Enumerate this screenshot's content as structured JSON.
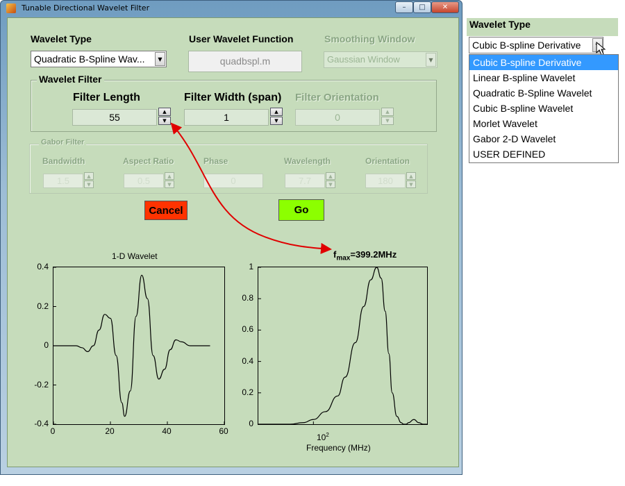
{
  "window": {
    "title": "Tunable Directional Wavelet Filter",
    "minimize_glyph": "–",
    "maximize_glyph": "□",
    "close_glyph": "✕"
  },
  "controls": {
    "wavelet_type_label": "Wavelet Type",
    "wavelet_type_value": "Quadratic B-Spline Wav...",
    "user_wavelet_label": "User Wavelet Function",
    "user_wavelet_value": "quadbspl.m",
    "smoothing_label": "Smoothing Window",
    "smoothing_value": "Gaussian Window"
  },
  "wavelet_filter": {
    "title": "Wavelet Filter",
    "length_label": "Filter Length",
    "length_value": "55",
    "width_label": "Filter Width (span)",
    "width_value": "1",
    "orientation_label": "Filter Orientation",
    "orientation_value": "0"
  },
  "gabor_filter": {
    "title": "Gabor Filter",
    "bandwidth_label": "Bandwidth",
    "bandwidth_value": "1.5",
    "aspect_label": "Aspect Ratio",
    "aspect_value": "0.5",
    "phase_label": "Phase",
    "phase_value": "0",
    "wavelength_label": "Wavelength",
    "wavelength_value": "7.7",
    "orientation_label": "Orientation",
    "orientation_value": "180"
  },
  "buttons": {
    "cancel": "Cancel",
    "go": "Go"
  },
  "colors": {
    "panel_bg": "#c6dcbb",
    "cancel_bg": "#ff3300",
    "go_bg": "#8cff00",
    "annotation_arrow": "#e00000",
    "selection": "#3399ff"
  },
  "annotation": {
    "f": "f",
    "sub": "max",
    "value": "=399.2MHz"
  },
  "right_panel": {
    "label": "Wavelet Type",
    "selected": "Cubic B-spline Derivative",
    "options": [
      "Cubic B-spline Derivative",
      "Linear B-spline Wavelet",
      "Quadratic B-Spline Wavelet",
      "Cubic B-spline Wavelet",
      "Morlet Wavelet",
      "Gabor 2-D Wavelet",
      "USER DEFINED"
    ],
    "highlighted_index": 0
  },
  "chart_data": [
    {
      "type": "line",
      "title": "1-D Wavelet",
      "xlim": [
        0,
        60
      ],
      "ylim": [
        -0.4,
        0.4
      ],
      "xticks": [
        "0",
        "20",
        "40",
        "60"
      ],
      "yticks": [
        "0.4",
        "0.2",
        "0",
        "-0.2",
        "-0.4"
      ],
      "x": [
        0,
        8,
        10,
        12,
        14,
        16,
        18,
        20,
        22,
        24,
        25,
        27,
        29,
        31,
        33,
        35,
        37,
        39,
        41,
        43,
        45,
        48,
        52,
        55
      ],
      "y": [
        0,
        0,
        -0.01,
        -0.03,
        0.0,
        0.08,
        0.16,
        0.14,
        -0.05,
        -0.29,
        -0.36,
        -0.23,
        0.15,
        0.36,
        0.24,
        -0.05,
        -0.17,
        -0.12,
        -0.02,
        0.03,
        0.02,
        0.0,
        0.0,
        0.0
      ]
    },
    {
      "type": "line",
      "xlabel": "Frequency (MHz)",
      "xscale": "log",
      "ylim": [
        0,
        1
      ],
      "xticks_label": "10",
      "xticks_exp": "2",
      "yticks": [
        "1",
        "0.8",
        "0.6",
        "0.4",
        "0.2",
        "0"
      ],
      "x": [
        30,
        60,
        80,
        100,
        130,
        170,
        200,
        250,
        300,
        350,
        399,
        440,
        480,
        520,
        560,
        620,
        680,
        720,
        760,
        800,
        900,
        1000,
        1100,
        1200
      ],
      "y": [
        0,
        0.0,
        0.01,
        0.03,
        0.08,
        0.18,
        0.3,
        0.52,
        0.75,
        0.92,
        1.0,
        0.93,
        0.72,
        0.45,
        0.2,
        0.05,
        0.01,
        0.0,
        0.0,
        0.01,
        0.03,
        0.01,
        0.0,
        0.0
      ]
    }
  ]
}
